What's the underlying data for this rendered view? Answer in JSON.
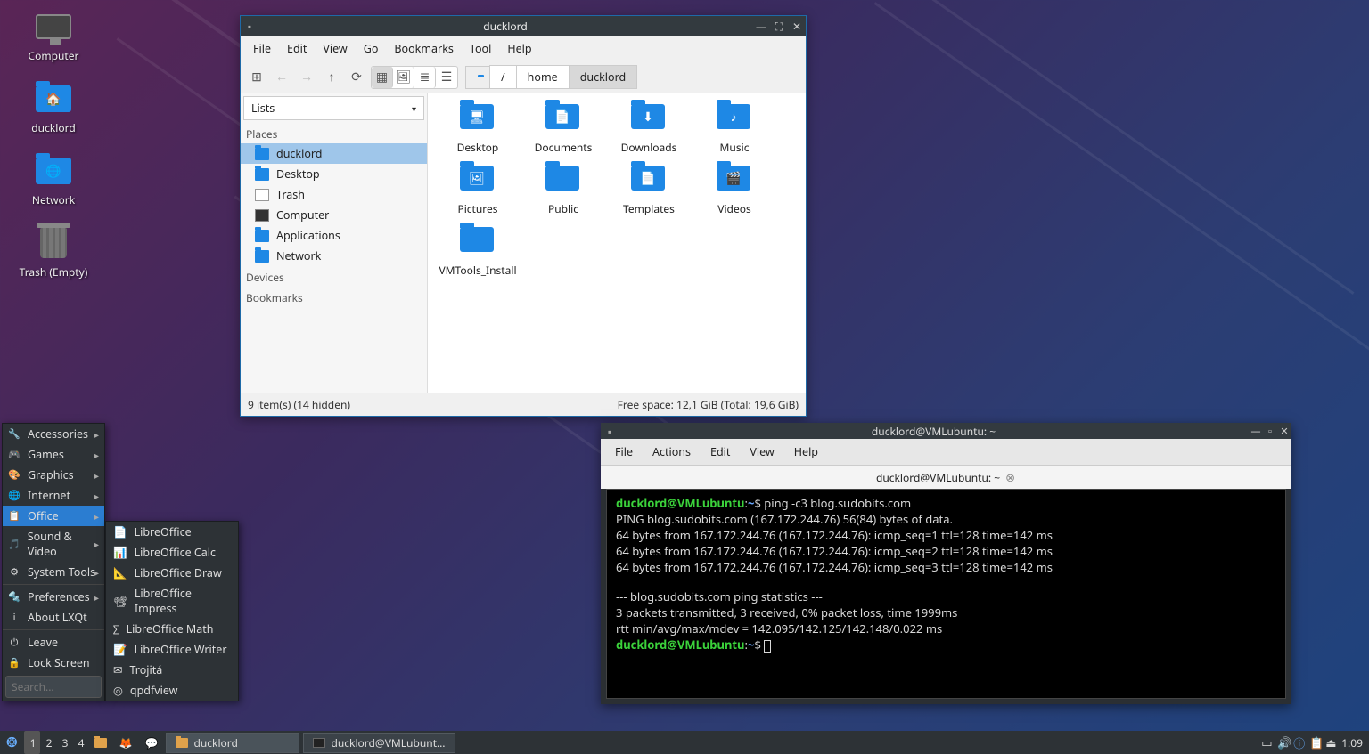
{
  "desktop": {
    "icons": [
      {
        "name": "computer",
        "label": "Computer"
      },
      {
        "name": "ducklord",
        "label": "ducklord"
      },
      {
        "name": "network",
        "label": "Network"
      },
      {
        "name": "trash",
        "label": "Trash (Empty)"
      }
    ]
  },
  "fm": {
    "title": "ducklord",
    "menu": [
      "File",
      "Edit",
      "View",
      "Go",
      "Bookmarks",
      "Tool",
      "Help"
    ],
    "dropdown": "Lists",
    "path": {
      "root": "/",
      "home": "home",
      "current": "ducklord"
    },
    "side_headers": {
      "places": "Places",
      "devices": "Devices",
      "bookmarks": "Bookmarks"
    },
    "places": [
      {
        "label": "ducklord",
        "sel": true,
        "icon": "folder"
      },
      {
        "label": "Desktop",
        "sel": false,
        "icon": "folder"
      },
      {
        "label": "Trash",
        "sel": false,
        "icon": "blank"
      },
      {
        "label": "Computer",
        "sel": false,
        "icon": "screen"
      },
      {
        "label": "Applications",
        "sel": false,
        "icon": "folder"
      },
      {
        "label": "Network",
        "sel": false,
        "icon": "net"
      }
    ],
    "items": [
      {
        "label": "Desktop",
        "glyph": "🖥"
      },
      {
        "label": "Documents",
        "glyph": "📄"
      },
      {
        "label": "Downloads",
        "glyph": "⬇"
      },
      {
        "label": "Music",
        "glyph": "♪"
      },
      {
        "label": "Pictures",
        "glyph": "🖼"
      },
      {
        "label": "Public",
        "glyph": ""
      },
      {
        "label": "Templates",
        "glyph": "📄"
      },
      {
        "label": "Videos",
        "glyph": "🎬"
      },
      {
        "label": "VMTools_Install",
        "glyph": ""
      }
    ],
    "status_left": "9 item(s) (14 hidden)",
    "status_right": "Free space: 12,1 GiB (Total: 19,6 GiB)"
  },
  "term": {
    "title": "ducklord@VMLubuntu: ~",
    "menu": [
      "File",
      "Actions",
      "Edit",
      "View",
      "Help"
    ],
    "tab": "ducklord@VMLubuntu: ~",
    "prompt_user": "ducklord@VMLubuntu",
    "prompt_path": "~",
    "cmd1": "ping -c3 blog.sudobits.com",
    "l1": "PING blog.sudobits.com (167.172.244.76) 56(84) bytes of data.",
    "l2": "64 bytes from 167.172.244.76 (167.172.244.76): icmp_seq=1 ttl=128 time=142 ms",
    "l3": "64 bytes from 167.172.244.76 (167.172.244.76): icmp_seq=2 ttl=128 time=142 ms",
    "l4": "64 bytes from 167.172.244.76 (167.172.244.76): icmp_seq=3 ttl=128 time=142 ms",
    "l5": "--- blog.sudobits.com ping statistics ---",
    "l6": "3 packets transmitted, 3 received, 0% packet loss, time 1999ms",
    "l7": "rtt min/avg/max/mdev = 142.095/142.125/142.148/0.022 ms"
  },
  "menu": {
    "categories": [
      {
        "label": "Accessories",
        "icon": "🔧",
        "arrow": true
      },
      {
        "label": "Games",
        "icon": "🎮",
        "arrow": true
      },
      {
        "label": "Graphics",
        "icon": "🎨",
        "arrow": true
      },
      {
        "label": "Internet",
        "icon": "🌐",
        "arrow": true
      },
      {
        "label": "Office",
        "icon": "📋",
        "arrow": true,
        "sel": true
      },
      {
        "label": "Sound & Video",
        "icon": "🎵",
        "arrow": true
      },
      {
        "label": "System Tools",
        "icon": "⚙",
        "arrow": true
      },
      {
        "label": "Preferences",
        "icon": "🔩",
        "arrow": true
      },
      {
        "label": "About LXQt",
        "icon": "ℹ",
        "arrow": false
      },
      {
        "label": "Leave",
        "icon": "⏻",
        "arrow": false
      },
      {
        "label": "Lock Screen",
        "icon": "🔒",
        "arrow": false
      }
    ],
    "search_placeholder": "Search...",
    "office": [
      {
        "label": "LibreOffice",
        "icon": "📄"
      },
      {
        "label": "LibreOffice Calc",
        "icon": "📊"
      },
      {
        "label": "LibreOffice Draw",
        "icon": "📐"
      },
      {
        "label": "LibreOffice Impress",
        "icon": "📽"
      },
      {
        "label": "LibreOffice Math",
        "icon": "∑"
      },
      {
        "label": "LibreOffice Writer",
        "icon": "📝"
      },
      {
        "label": "Trojitá",
        "icon": "✉"
      },
      {
        "label": "qpdfview",
        "icon": "◎"
      }
    ]
  },
  "taskbar": {
    "workspaces": [
      "1",
      "2",
      "3",
      "4"
    ],
    "apps": [
      {
        "label": "ducklord",
        "icon": "folder",
        "active": true
      },
      {
        "label": "ducklord@VMLubunt…",
        "icon": "screen",
        "active": false
      }
    ],
    "clock": "1:09"
  }
}
